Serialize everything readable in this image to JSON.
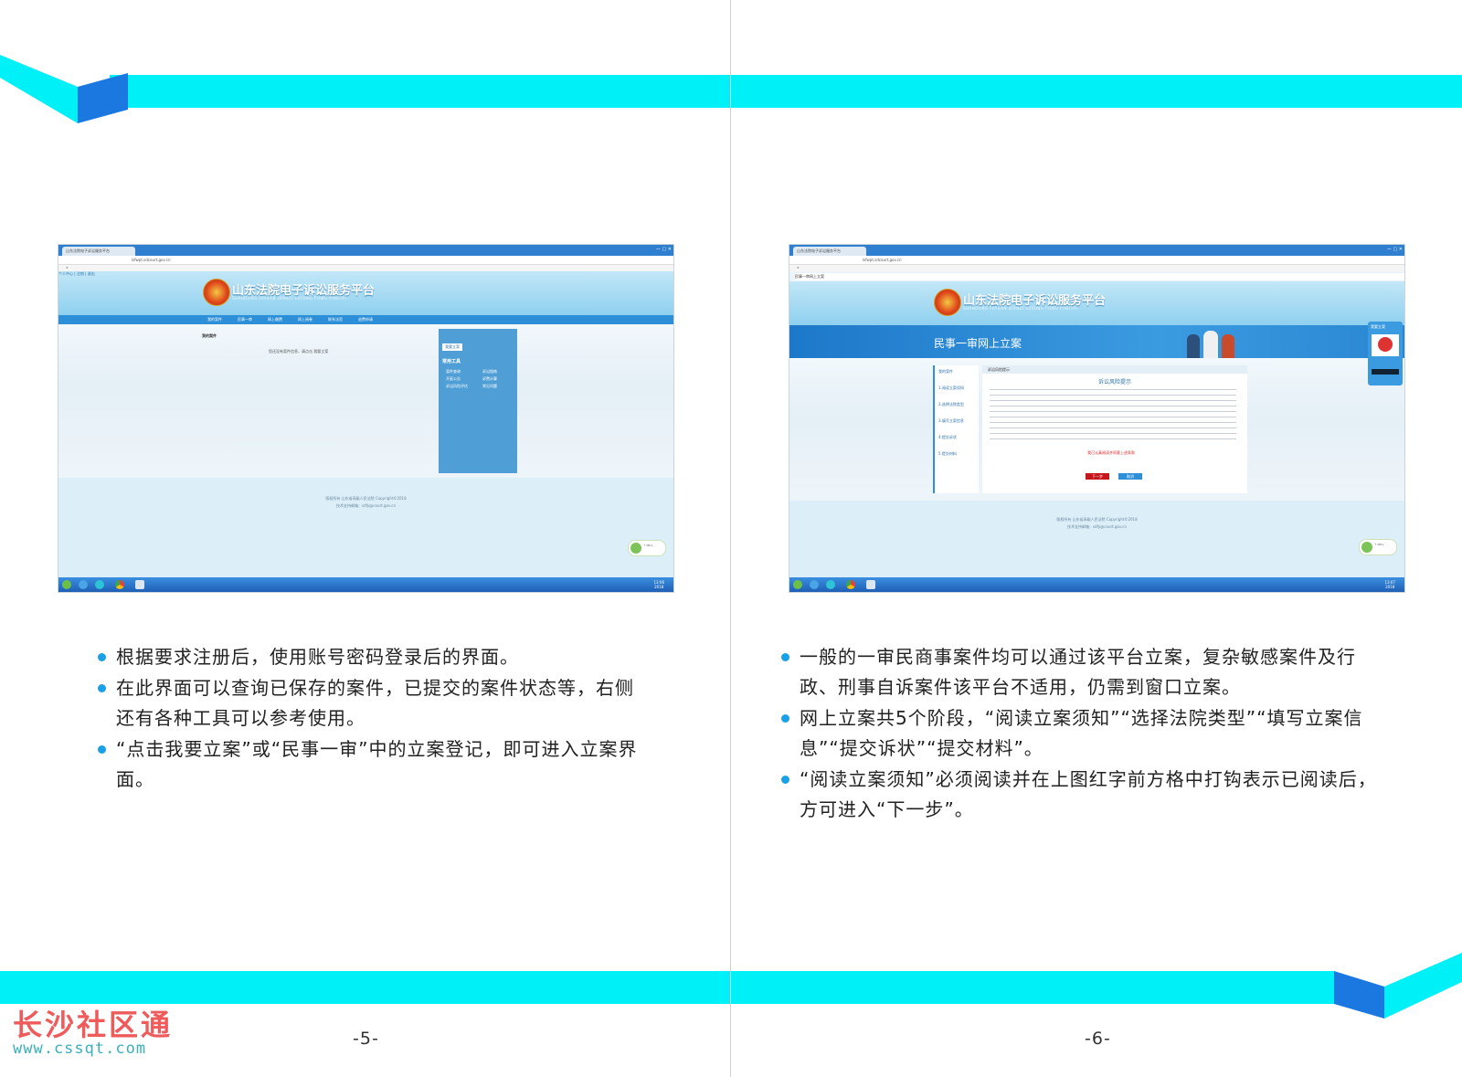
{
  "left_page": {
    "page_number": "-5-",
    "bullets": [
      "根据要求注册后，使用账号密码登录后的界面。",
      "在此界面可以查询已保存的案件，已提交的案件状态等，右侧还有各种工具可以参考使用。",
      "“点击我要立案”或“民事一审”中的立案登记，即可进入立案界面。"
    ],
    "screenshot": {
      "tab_title": "山东法院电子诉讼服务平台",
      "address": "lsfwpt.sdcourt.gov.cn",
      "site_title": "山东法院电子诉讼服务平台",
      "site_subtitle": "SHANDONG FAYUAN DIANZI SUSONG FUWU PINGTAI",
      "top_links": [
        "个人中心",
        "注销",
        "退出"
      ],
      "nav": [
        "我的案件",
        "民事一审",
        "网上缴费",
        "网上阅卷",
        "联系法官",
        "退费申请"
      ],
      "section_title": "我的案件",
      "empty_text": "您还没有案件信息，请点击 我要立案",
      "panel_button": "我要立案",
      "panel_title": "常用工具",
      "panel_items": [
        "案件查询",
        "诉讼指南",
        "开庭公告",
        "诉费计算",
        "诉讼风险评估",
        "常见问题"
      ],
      "footer_line1": "版权所有 山东省高级人民法院 Copyright©2018",
      "footer_line2": "技术支持邮箱：sdfy@court.gov.cn"
    }
  },
  "right_page": {
    "page_number": "-6-",
    "bullets": [
      "一般的一审民商事案件均可以通过该平台立案，复杂敏感案件及行政、刑事自诉案件该平台不适用，仍需到窗口立案。",
      "网上立案共5个阶段，“阅读立案须知”“选择法院类型”“填写立案信息”“提交诉状”“提交材料”。",
      "“阅读立案须知”必须阅读并在上图红字前方格中打钩表示已阅读后，方可进入“下一步”。"
    ],
    "screenshot": {
      "tab_title": "山东法院电子诉讼服务平台",
      "address": "lsfwpt.sdcourt.gov.cn",
      "breadcrumb": "民事一审网上立案",
      "site_title": "山东法院电子诉讼服务平台",
      "site_subtitle": "SHANDONG FAYUAN DIANZI SUSONG FUWU PINGTAI",
      "banner_title": "民事一审网上立案",
      "steps_header": "我的案件",
      "steps": [
        "1.阅读立案须知",
        "2.选择法院类型",
        "3.填写立案信息",
        "4.提交诉状",
        "5.提交材料"
      ],
      "content_header": "诉讼风险提示",
      "content_title": "诉讼风险提示",
      "agree_text": "我已认真阅读并同意上述条款",
      "next_button": "下一步",
      "cancel_button": "取消",
      "side_widget_title": "我要立案",
      "footer_line1": "版权所有 山东省高级人民法院 Copyright©2018",
      "footer_line2": "技术支持邮箱：sdfy@court.gov.cn"
    }
  },
  "watermark": {
    "brand": "长沙社区通",
    "url": "www.cssqt.com"
  },
  "colors": {
    "band": "#00f0f8",
    "band_accent": "#1a78e0",
    "bullet": "#1aa0e6",
    "watermark": "#ef5a5a"
  }
}
